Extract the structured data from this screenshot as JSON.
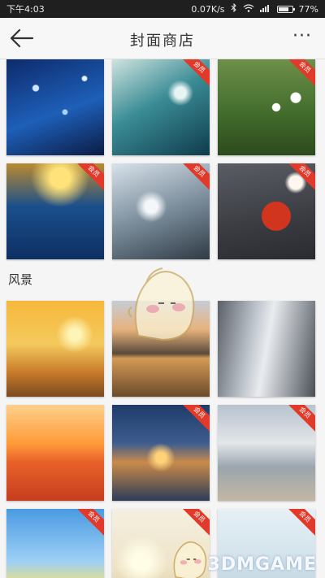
{
  "status_bar": {
    "carrier_time": "下午4:03",
    "net_speed": "0.07K/s",
    "battery": "77%",
    "battery_level": 0.77
  },
  "app_bar": {
    "title": "封面商店",
    "back_icon": "arrow-left-icon",
    "more_icon": "more-dots-icon",
    "more_label": "···"
  },
  "sections": [
    {
      "label": "",
      "tiles": [
        {
          "theme": "blue-bokeh-lights",
          "tag": ""
        },
        {
          "theme": "teal-snow-branches",
          "tag": "会员"
        },
        {
          "theme": "daisies-windmill",
          "tag": "会员"
        },
        {
          "theme": "blue-grass-sunset",
          "tag": "会员"
        },
        {
          "theme": "frosted-plants",
          "tag": "会员"
        },
        {
          "theme": "red-pendant-flowers",
          "tag": "会员"
        }
      ]
    },
    {
      "label": "风景",
      "tiles": [
        {
          "theme": "golden-street-lamp",
          "tag": ""
        },
        {
          "theme": "lake-boat-sunset",
          "tag": ""
        },
        {
          "theme": "wall-street-buildings",
          "tag": ""
        },
        {
          "theme": "orange-sea-sunset",
          "tag": ""
        },
        {
          "theme": "lighthouse-sunset",
          "tag": "会员"
        },
        {
          "theme": "pier-cloudy-sky",
          "tag": "会员"
        },
        {
          "theme": "blue-sky-field",
          "tag": "会员"
        },
        {
          "theme": "sun-grass",
          "tag": "会员"
        },
        {
          "theme": "pale-branches",
          "tag": "会员"
        }
      ]
    }
  ],
  "watermark": "3DMGAME"
}
